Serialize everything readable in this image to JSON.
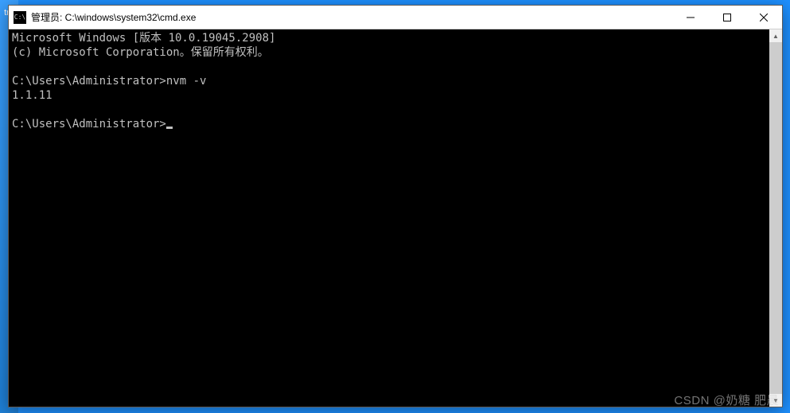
{
  "desktop": {
    "edge_label": "tra"
  },
  "window": {
    "title": "管理员: C:\\windows\\system32\\cmd.exe",
    "icon_glyph": "C:\\"
  },
  "terminal": {
    "line1": "Microsoft Windows [版本 10.0.19045.2908]",
    "line2": "(c) Microsoft Corporation。保留所有权利。",
    "blank1": "",
    "prompt1_path": "C:\\Users\\Administrator>",
    "prompt1_cmd": "nvm -v",
    "output1": "1.1.11",
    "blank2": "",
    "prompt2_path": "C:\\Users\\Administrator>"
  },
  "watermark": "CSDN @奶糖 肥晨"
}
